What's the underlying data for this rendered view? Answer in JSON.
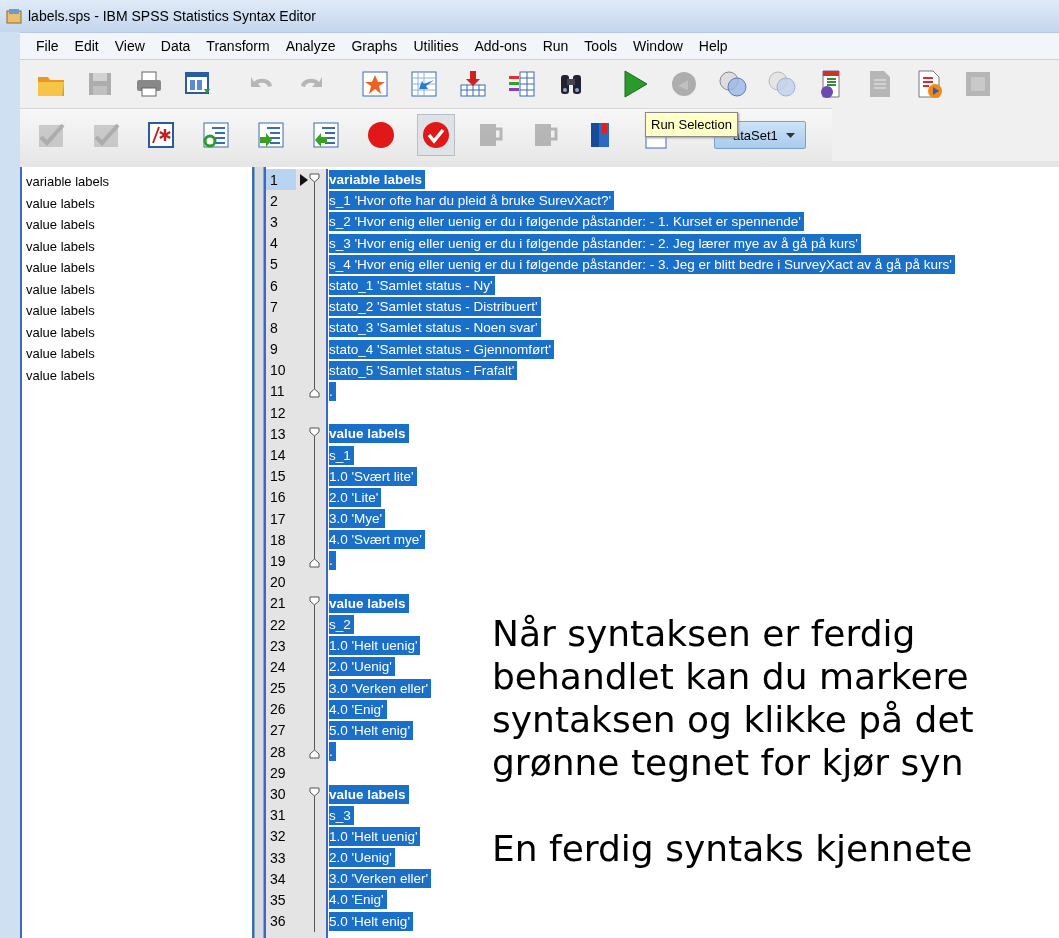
{
  "window": {
    "title": "labels.sps - IBM SPSS Statistics Syntax Editor"
  },
  "menu": [
    "File",
    "Edit",
    "View",
    "Data",
    "Transform",
    "Analyze",
    "Graphs",
    "Utilities",
    "Add-ons",
    "Run",
    "Tools",
    "Window",
    "Help"
  ],
  "toolbar_1": [
    {
      "kind": "folder",
      "disabled": false
    },
    {
      "kind": "disk",
      "disabled": true
    },
    {
      "kind": "printer",
      "disabled": false
    },
    {
      "kind": "dialog",
      "disabled": false
    },
    {
      "kind": "undo",
      "disabled": true
    },
    {
      "kind": "redo",
      "disabled": true
    },
    {
      "kind": "star-grid",
      "disabled": false
    },
    {
      "kind": "grid-arrow",
      "disabled": false
    },
    {
      "kind": "grid-down",
      "disabled": false
    },
    {
      "kind": "columns",
      "disabled": false
    },
    {
      "kind": "binoculars",
      "disabled": false
    },
    {
      "kind": "play",
      "disabled": false
    },
    {
      "kind": "disc",
      "disabled": true
    },
    {
      "kind": "circles",
      "disabled": false
    },
    {
      "kind": "circles",
      "disabled": true
    },
    {
      "kind": "doc-question",
      "disabled": false
    },
    {
      "kind": "doc",
      "disabled": true
    },
    {
      "kind": "doc-play",
      "disabled": false
    },
    {
      "kind": "square",
      "disabled": true
    }
  ],
  "toolbar_2": [
    {
      "kind": "tick",
      "disabled": true
    },
    {
      "kind": "tick",
      "disabled": true
    },
    {
      "kind": "comment",
      "disabled": false
    },
    {
      "kind": "list-circle",
      "disabled": false
    },
    {
      "kind": "list-right",
      "disabled": false
    },
    {
      "kind": "list-left",
      "disabled": false
    },
    {
      "kind": "red-dot",
      "disabled": false
    },
    {
      "kind": "check-circle",
      "disabled": false
    },
    {
      "kind": "cup",
      "disabled": true
    },
    {
      "kind": "cup",
      "disabled": true
    },
    {
      "kind": "books",
      "disabled": false
    },
    {
      "kind": "small-doc",
      "disabled": false
    }
  ],
  "dataset_dropdown": {
    "value": "ataSet1"
  },
  "tooltip": {
    "text": "Run Selection"
  },
  "navigation": {
    "items": [
      "variable labels",
      "value labels",
      "value labels",
      "value labels",
      "value labels",
      "value labels",
      "value labels",
      "value labels",
      "value labels",
      "value labels"
    ]
  },
  "editor": {
    "lines": [
      {
        "number": "1",
        "text": "variable labels",
        "kind": "command",
        "current": true,
        "selected": true
      },
      {
        "number": "2",
        "text": "s_1 'Hvor ofte har du pleid å bruke SurevXact?'",
        "kind": "plain",
        "current": false,
        "selected": true
      },
      {
        "number": "3",
        "text": "s_2 'Hvor enig eller uenig er du i følgende påstander: - 1. Kurset er spennende'",
        "kind": "plain",
        "current": false,
        "selected": true
      },
      {
        "number": "4",
        "text": "s_3 'Hvor enig eller uenig er du i følgende påstander: - 2. Jeg lærer mye av å gå på kurs'",
        "kind": "plain",
        "current": false,
        "selected": true
      },
      {
        "number": "5",
        "text": "s_4 'Hvor enig eller uenig er du i følgende påstander: - 3. Jeg er blitt bedre i SurveyXact av å gå på kurs'",
        "kind": "plain",
        "current": false,
        "selected": true
      },
      {
        "number": "6",
        "text": "stato_1 'Samlet status - Ny'",
        "kind": "plain",
        "current": false,
        "selected": true
      },
      {
        "number": "7",
        "text": "stato_2 'Samlet status - Distribuert'",
        "kind": "plain",
        "current": false,
        "selected": true
      },
      {
        "number": "8",
        "text": "stato_3 'Samlet status - Noen svar'",
        "kind": "plain",
        "current": false,
        "selected": true
      },
      {
        "number": "9",
        "text": "stato_4 'Samlet status - Gjennomført'",
        "kind": "plain",
        "current": false,
        "selected": true
      },
      {
        "number": "10",
        "text": "stato_5 'Samlet status - Frafalt'",
        "kind": "plain",
        "current": false,
        "selected": true
      },
      {
        "number": "11",
        "text": ".",
        "kind": "terminator",
        "current": false,
        "selected": true
      },
      {
        "number": "12",
        "kind": "blank",
        "current": false
      },
      {
        "number": "13",
        "text": "value labels",
        "kind": "command",
        "current": false,
        "selected": true
      },
      {
        "number": "14",
        "text": "s_1",
        "kind": "plain",
        "current": false,
        "selected": true
      },
      {
        "number": "15",
        "text": "1.0 'Svært lite'",
        "kind": "plain",
        "current": false,
        "selected": true
      },
      {
        "number": "16",
        "text": "2.0 'Lite'",
        "kind": "plain",
        "current": false,
        "selected": true
      },
      {
        "number": "17",
        "text": "3.0 'Mye'",
        "kind": "plain",
        "current": false,
        "selected": true
      },
      {
        "number": "18",
        "text": "4.0 'Svært mye'",
        "kind": "plain",
        "current": false,
        "selected": true
      },
      {
        "number": "19",
        "text": ".",
        "kind": "terminator",
        "current": false,
        "selected": true
      },
      {
        "number": "20",
        "kind": "blank",
        "current": false
      },
      {
        "number": "21",
        "text": "value labels",
        "kind": "command",
        "current": false,
        "selected": true
      },
      {
        "number": "22",
        "text": "s_2",
        "kind": "plain",
        "current": false,
        "selected": true
      },
      {
        "number": "23",
        "text": "1.0 'Helt uenig'",
        "kind": "plain",
        "current": false,
        "selected": true
      },
      {
        "number": "24",
        "text": "2.0 'Uenig'",
        "kind": "plain",
        "current": false,
        "selected": true
      },
      {
        "number": "25",
        "text": "3.0 'Verken eller'",
        "kind": "plain",
        "current": false,
        "selected": true
      },
      {
        "number": "26",
        "text": "4.0 'Enig'",
        "kind": "plain",
        "current": false,
        "selected": true
      },
      {
        "number": "27",
        "text": "5.0 'Helt enig'",
        "kind": "plain",
        "current": false,
        "selected": true
      },
      {
        "number": "28",
        "text": ".",
        "kind": "terminator",
        "current": false,
        "selected": true
      },
      {
        "number": "29",
        "kind": "blank",
        "current": false
      },
      {
        "number": "30",
        "text": "value labels",
        "kind": "command",
        "current": false,
        "selected": true
      },
      {
        "number": "31",
        "text": "s_3",
        "kind": "plain",
        "current": false,
        "selected": true
      },
      {
        "number": "32",
        "text": "1.0 'Helt uenig'",
        "kind": "plain",
        "current": false,
        "selected": true
      },
      {
        "number": "33",
        "text": "2.0 'Uenig'",
        "kind": "plain",
        "current": false,
        "selected": true
      },
      {
        "number": "34",
        "text": "3.0 'Verken eller'",
        "kind": "plain",
        "current": false,
        "selected": true
      },
      {
        "number": "35",
        "text": "4.0 'Enig'",
        "kind": "plain",
        "current": false,
        "selected": true
      },
      {
        "number": "36",
        "text": "5.0 'Helt enig'",
        "kind": "plain",
        "current": false,
        "selected": true
      }
    ]
  },
  "annotation": {
    "paragraphs": [
      [
        "Når syntaksen er ferdig",
        "behandlet kan du markere",
        "syntaksen og klikke på det",
        "grønne tegnet for kjør syn"
      ],
      [
        "En ferdig syntaks kjennete"
      ]
    ]
  }
}
